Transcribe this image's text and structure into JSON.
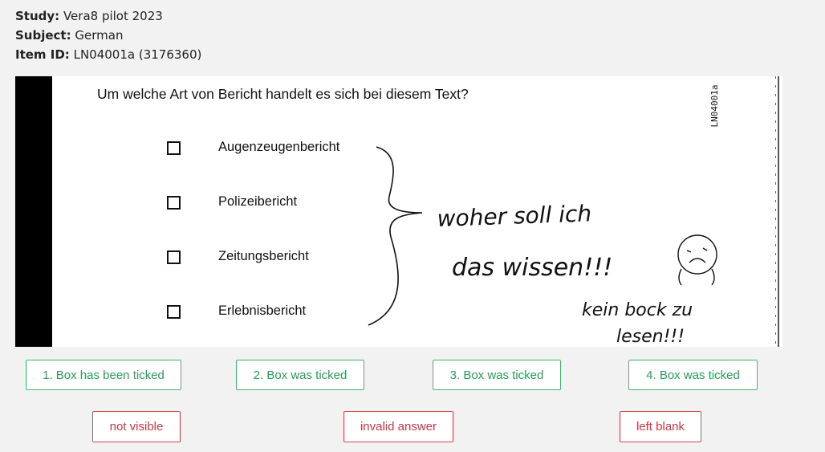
{
  "meta": {
    "study_label": "Study:",
    "study_value": "Vera8 pilot 2023",
    "subject_label": "Subject:",
    "subject_value": "German",
    "item_label": "Item ID:",
    "item_value": "LN04001a (3176360)"
  },
  "scan": {
    "question": "Um welche Art von Bericht handelt es sich bei diesem Text?",
    "item_code": "LN04001a",
    "options": [
      "Augenzeugenbericht",
      "Polizeibericht",
      "Zeitungsbericht",
      "Erlebnisbericht"
    ],
    "handwriting": {
      "line1": "woher soll ich",
      "line2": "das wissen!!!",
      "line3": "kein bock zu",
      "line4": "lesen!!!"
    }
  },
  "score_buttons": [
    "1. Box has been ticked",
    "2. Box was ticked",
    "3. Box was ticked",
    "4. Box was ticked"
  ],
  "code_buttons": {
    "not_visible": "not visible",
    "invalid": "invalid answer",
    "blank": "left blank"
  },
  "colors": {
    "score_button_accent": "#3dbb6c",
    "code_button_accent": "#d6454f",
    "background": "#f2f2f2"
  }
}
